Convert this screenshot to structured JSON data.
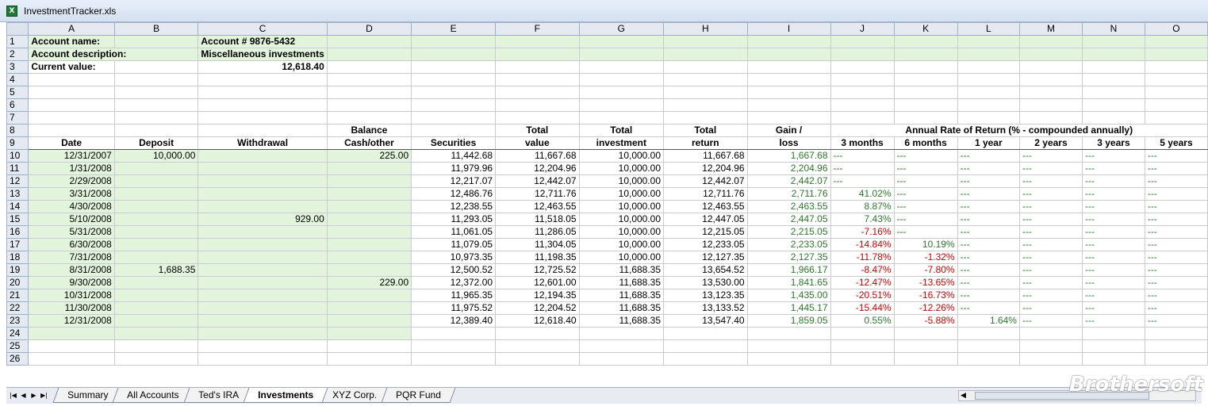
{
  "window": {
    "title": "InvestmentTracker.xls",
    "icon": "excel-icon"
  },
  "columns": [
    "A",
    "B",
    "C",
    "D",
    "E",
    "F",
    "G",
    "H",
    "I",
    "J",
    "K",
    "L",
    "M",
    "N",
    "O"
  ],
  "header": {
    "account_name_label": "Account name:",
    "account_name_value": "Account # 9876-5432",
    "account_desc_label": "Account description:",
    "account_desc_value": "Miscellaneous investments",
    "current_value_label": "Current value:",
    "current_value": "12,618.40"
  },
  "headers_row8": {
    "balance": "Balance",
    "total1": "Total",
    "total2": "Total",
    "total3": "Total",
    "gain": "Gain /",
    "annual": "Annual Rate of Return (% - compounded annually)"
  },
  "headers_row9": {
    "date": "Date",
    "deposit": "Deposit",
    "withdrawal": "Withdrawal",
    "cash": "Cash/other",
    "securities": "Securities",
    "value": "value",
    "investment": "investment",
    "return": "return",
    "loss": "loss",
    "m3": "3 months",
    "m6": "6 months",
    "y1": "1 year",
    "y2": "2 years",
    "y3": "3 years",
    "y5": "5 years"
  },
  "rows": [
    {
      "date": "12/31/2007",
      "deposit": "10,000.00",
      "withdrawal": "",
      "cash": "225.00",
      "sec": "11,442.68",
      "val": "11,667.68",
      "inv": "10,000.00",
      "ret": "11,667.68",
      "gain": "1,667.68",
      "m3": "---",
      "m6": "---",
      "y1": "---",
      "y2": "---",
      "y3": "---",
      "y5": "---"
    },
    {
      "date": "1/31/2008",
      "deposit": "",
      "withdrawal": "",
      "cash": "",
      "sec": "11,979.96",
      "val": "12,204.96",
      "inv": "10,000.00",
      "ret": "12,204.96",
      "gain": "2,204.96",
      "m3": "---",
      "m6": "---",
      "y1": "---",
      "y2": "---",
      "y3": "---",
      "y5": "---"
    },
    {
      "date": "2/29/2008",
      "deposit": "",
      "withdrawal": "",
      "cash": "",
      "sec": "12,217.07",
      "val": "12,442.07",
      "inv": "10,000.00",
      "ret": "12,442.07",
      "gain": "2,442.07",
      "m3": "---",
      "m6": "---",
      "y1": "---",
      "y2": "---",
      "y3": "---",
      "y5": "---"
    },
    {
      "date": "3/31/2008",
      "deposit": "",
      "withdrawal": "",
      "cash": "",
      "sec": "12,486.76",
      "val": "12,711.76",
      "inv": "10,000.00",
      "ret": "12,711.76",
      "gain": "2,711.76",
      "m3": "41.02%",
      "m6": "---",
      "y1": "---",
      "y2": "---",
      "y3": "---",
      "y5": "---"
    },
    {
      "date": "4/30/2008",
      "deposit": "",
      "withdrawal": "",
      "cash": "",
      "sec": "12,238.55",
      "val": "12,463.55",
      "inv": "10,000.00",
      "ret": "12,463.55",
      "gain": "2,463.55",
      "m3": "8.87%",
      "m6": "---",
      "y1": "---",
      "y2": "---",
      "y3": "---",
      "y5": "---"
    },
    {
      "date": "5/10/2008",
      "deposit": "",
      "withdrawal": "929.00",
      "cash": "",
      "sec": "11,293.05",
      "val": "11,518.05",
      "inv": "10,000.00",
      "ret": "12,447.05",
      "gain": "2,447.05",
      "m3": "7.43%",
      "m6": "---",
      "y1": "---",
      "y2": "---",
      "y3": "---",
      "y5": "---"
    },
    {
      "date": "5/31/2008",
      "deposit": "",
      "withdrawal": "",
      "cash": "",
      "sec": "11,061.05",
      "val": "11,286.05",
      "inv": "10,000.00",
      "ret": "12,215.05",
      "gain": "2,215.05",
      "m3": "-7.16%",
      "m6": "---",
      "y1": "---",
      "y2": "---",
      "y3": "---",
      "y5": "---"
    },
    {
      "date": "6/30/2008",
      "deposit": "",
      "withdrawal": "",
      "cash": "",
      "sec": "11,079.05",
      "val": "11,304.05",
      "inv": "10,000.00",
      "ret": "12,233.05",
      "gain": "2,233.05",
      "m3": "-14.84%",
      "m6": "10.19%",
      "y1": "---",
      "y2": "---",
      "y3": "---",
      "y5": "---"
    },
    {
      "date": "7/31/2008",
      "deposit": "",
      "withdrawal": "",
      "cash": "",
      "sec": "10,973.35",
      "val": "11,198.35",
      "inv": "10,000.00",
      "ret": "12,127.35",
      "gain": "2,127.35",
      "m3": "-11.78%",
      "m6": "-1.32%",
      "y1": "---",
      "y2": "---",
      "y3": "---",
      "y5": "---"
    },
    {
      "date": "8/31/2008",
      "deposit": "1,688.35",
      "withdrawal": "",
      "cash": "",
      "sec": "12,500.52",
      "val": "12,725.52",
      "inv": "11,688.35",
      "ret": "13,654.52",
      "gain": "1,966.17",
      "m3": "-8.47%",
      "m6": "-7.80%",
      "y1": "---",
      "y2": "---",
      "y3": "---",
      "y5": "---"
    },
    {
      "date": "9/30/2008",
      "deposit": "",
      "withdrawal": "",
      "cash": "229.00",
      "sec": "12,372.00",
      "val": "12,601.00",
      "inv": "11,688.35",
      "ret": "13,530.00",
      "gain": "1,841.65",
      "m3": "-12.47%",
      "m6": "-13.65%",
      "y1": "---",
      "y2": "---",
      "y3": "---",
      "y5": "---"
    },
    {
      "date": "10/31/2008",
      "deposit": "",
      "withdrawal": "",
      "cash": "",
      "sec": "11,965.35",
      "val": "12,194.35",
      "inv": "11,688.35",
      "ret": "13,123.35",
      "gain": "1,435.00",
      "m3": "-20.51%",
      "m6": "-16.73%",
      "y1": "---",
      "y2": "---",
      "y3": "---",
      "y5": "---"
    },
    {
      "date": "11/30/2008",
      "deposit": "",
      "withdrawal": "",
      "cash": "",
      "sec": "11,975.52",
      "val": "12,204.52",
      "inv": "11,688.35",
      "ret": "13,133.52",
      "gain": "1,445.17",
      "m3": "-15.44%",
      "m6": "-12.26%",
      "y1": "---",
      "y2": "---",
      "y3": "---",
      "y5": "---"
    },
    {
      "date": "12/31/2008",
      "deposit": "",
      "withdrawal": "",
      "cash": "",
      "sec": "12,389.40",
      "val": "12,618.40",
      "inv": "11,688.35",
      "ret": "13,547.40",
      "gain": "1,859.05",
      "m3": "0.55%",
      "m6": "-5.88%",
      "y1": "1.64%",
      "y2": "---",
      "y3": "---",
      "y5": "---"
    }
  ],
  "tabs": [
    {
      "label": "Summary",
      "active": false
    },
    {
      "label": "All Accounts",
      "active": false
    },
    {
      "label": "Ted's IRA",
      "active": false
    },
    {
      "label": "Investments",
      "active": true
    },
    {
      "label": "XYZ Corp.",
      "active": false
    },
    {
      "label": "PQR Fund",
      "active": false
    }
  ],
  "nav": [
    "first-sheet-icon",
    "prev-sheet-icon",
    "next-sheet-icon",
    "last-sheet-icon"
  ],
  "watermark": "Brothersoft",
  "colors": {
    "positive": "#2d7a2d",
    "negative": "#cc0000",
    "input_fill": "#e2f4dc",
    "header_fill": "#e4e9f2"
  }
}
